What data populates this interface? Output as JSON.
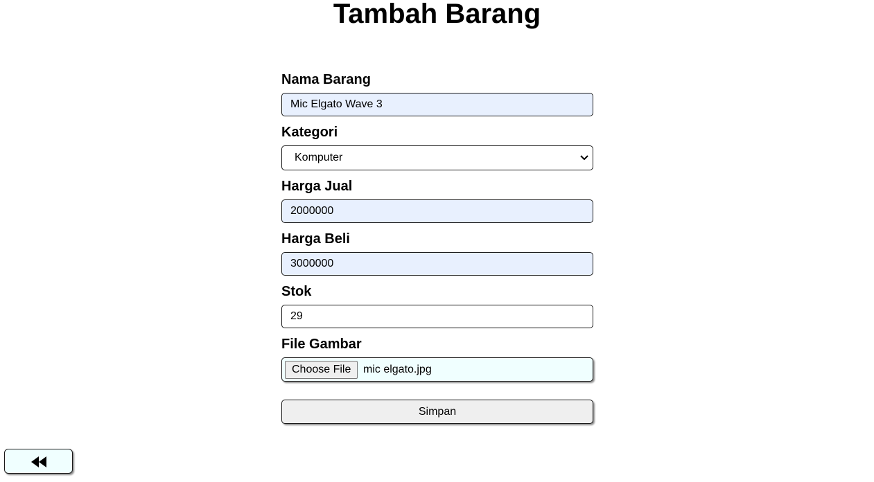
{
  "page": {
    "title": "Tambah Barang"
  },
  "form": {
    "nama_barang": {
      "label": "Nama Barang",
      "value": "Mic Elgato Wave 3"
    },
    "kategori": {
      "label": "Kategori",
      "selected": "Komputer"
    },
    "harga_jual": {
      "label": "Harga Jual",
      "value": "2000000"
    },
    "harga_beli": {
      "label": "Harga Beli",
      "value": "3000000"
    },
    "stok": {
      "label": "Stok",
      "value": "29"
    },
    "file_gambar": {
      "label": "File Gambar",
      "button_label": "Choose File",
      "file_name": "mic elgato.jpg"
    },
    "submit_label": "Simpan"
  },
  "back_button": {
    "icon": "rewind-icon"
  },
  "colors": {
    "autofill_bg": "#e8f0fe",
    "file_bg": "#f0ffff",
    "button_bg": "#efefef"
  }
}
